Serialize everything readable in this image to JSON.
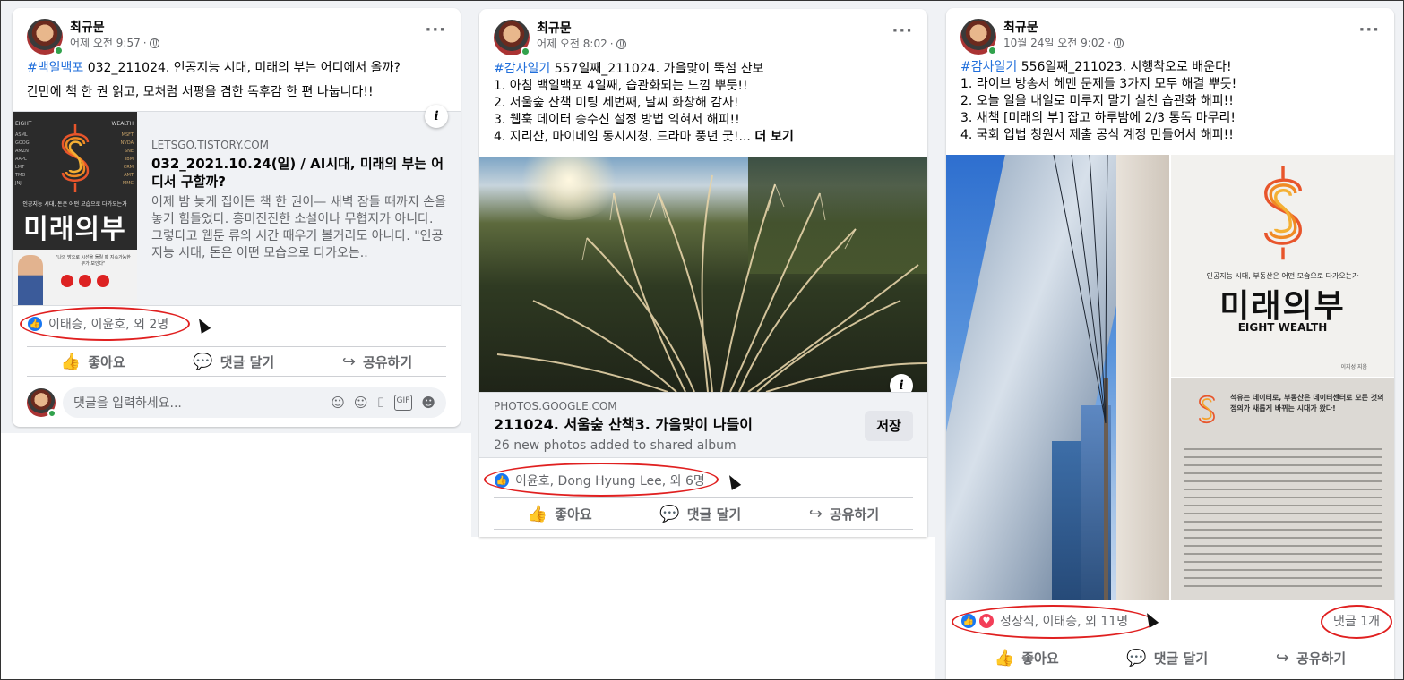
{
  "posts": [
    {
      "author": "최규문",
      "time": "어제 오전 9:57",
      "hashtag": "#백일백포",
      "line1_rest": " 032_211024. 인공지능 시대, 미래의 부는 어디에서 올까?",
      "line2": "간만에 책 한 권 읽고, 모처럼 서평을 겸한 독후감 한 편 나눕니다!!",
      "link": {
        "domain": "LETSGO.TISTORY.COM",
        "title": "032_2021.10.24(일) / AI시대, 미래의 부는 어디서 구할까?",
        "desc": "어제 밤 늦게 집어든 책 한 권이— 새벽 잠들 때까지 손을 놓기 힘들었다. 흥미진진한 소설이나 무협지가 아니다. 그렇다고 웹툰 류의 시간 때우기 볼거리도 아니다. \"인공지능 시대, 돈은 어떤 모습으로 다가오는..",
        "book_left_top": "EIGHT",
        "book_right_top": "WEALTH",
        "book_tickers": [
          "ASML",
          "GOOG",
          "AMZN",
          "AAPL",
          "LMT",
          "TMO",
          "JNJ"
        ],
        "book_tickers_right": [
          "MSFT",
          "NVDA",
          "SNE",
          "IBM",
          "CRM",
          "AMT",
          "MMC"
        ],
        "book_subtitle": "인공지능 시대, 돈은 어떤 모습으로 다가오는가",
        "book_title": "미래의부",
        "book_quote": "\"나의 방으로 시선을 돌릴 때 지속가능한 부가 보인다\""
      },
      "reactions": "이태승, 이윤호, 외 2명",
      "actions": {
        "like": "좋아요",
        "comment": "댓글 달기",
        "share": "공유하기"
      },
      "comment_placeholder": "댓글을 입력하세요..."
    },
    {
      "author": "최규문",
      "time": "어제 오전 8:02",
      "hashtag": "#감사일기",
      "line1_rest": " 557일째_211024. 가을맞이 뚝섬 산보",
      "lines": [
        "1. 아침 백일백포 4일째, 습관화되는 느낌 뿌듯!!",
        "2. 서울숲 산책 미팅 세번째, 날씨 화창해 감사!",
        "3. 웹훅 데이터 송수신 설정 방법 익혀서 해피!!",
        "4. 지리산, 마이네임 동시시청, 드라마 풍년 굿!... "
      ],
      "see_more": "더 보기",
      "link": {
        "domain": "PHOTOS.GOOGLE.COM",
        "title": "211024. 서울숲 산책3. 가을맞이 나들이",
        "desc": "26 new photos added to shared album",
        "save": "저장"
      },
      "reactions": "이윤호, Dong Hyung Lee, 외 6명",
      "actions": {
        "like": "좋아요",
        "comment": "댓글 달기",
        "share": "공유하기"
      }
    },
    {
      "author": "최규문",
      "time": "10월 24일 오전 9:02",
      "hashtag": "#감사일기",
      "line1_rest": " 556일째_211023. 시행착오로 배운다!",
      "lines": [
        "1. 라이브 방송서 헤맨 문제들 3가지 모두 해결 뿌듯!",
        "2. 오늘 일을 내일로 미루지 말기 실천 습관화 해피!!",
        "3. 새책  [미래의 부] 잡고 하루밤에 2/3 통독 마무리!",
        "4. 국회 입법 청원서 제출 공식 계정 만들어서 해피!!"
      ],
      "book": {
        "subtitle": "인공지능 시대, 부동산은 어떤 모습으로 다가오는가",
        "title": "미래의부",
        "english": "EIGHT WEALTH",
        "author": "이지성 지음",
        "page_headline": "석유는 데이터로, 부동산은 데이터센터로 모든 것의 정의가 새롭게 바뀌는 시대가 왔다!"
      },
      "reactions": "정장식, 이태승, 외 11명",
      "comments": "댓글 1개",
      "actions": {
        "like": "좋아요",
        "comment": "댓글 달기",
        "share": "공유하기"
      }
    }
  ],
  "colors": {
    "facebook_blue": "#1877f2",
    "hashtag": "#216fdb",
    "annotation_red": "#e02020"
  }
}
